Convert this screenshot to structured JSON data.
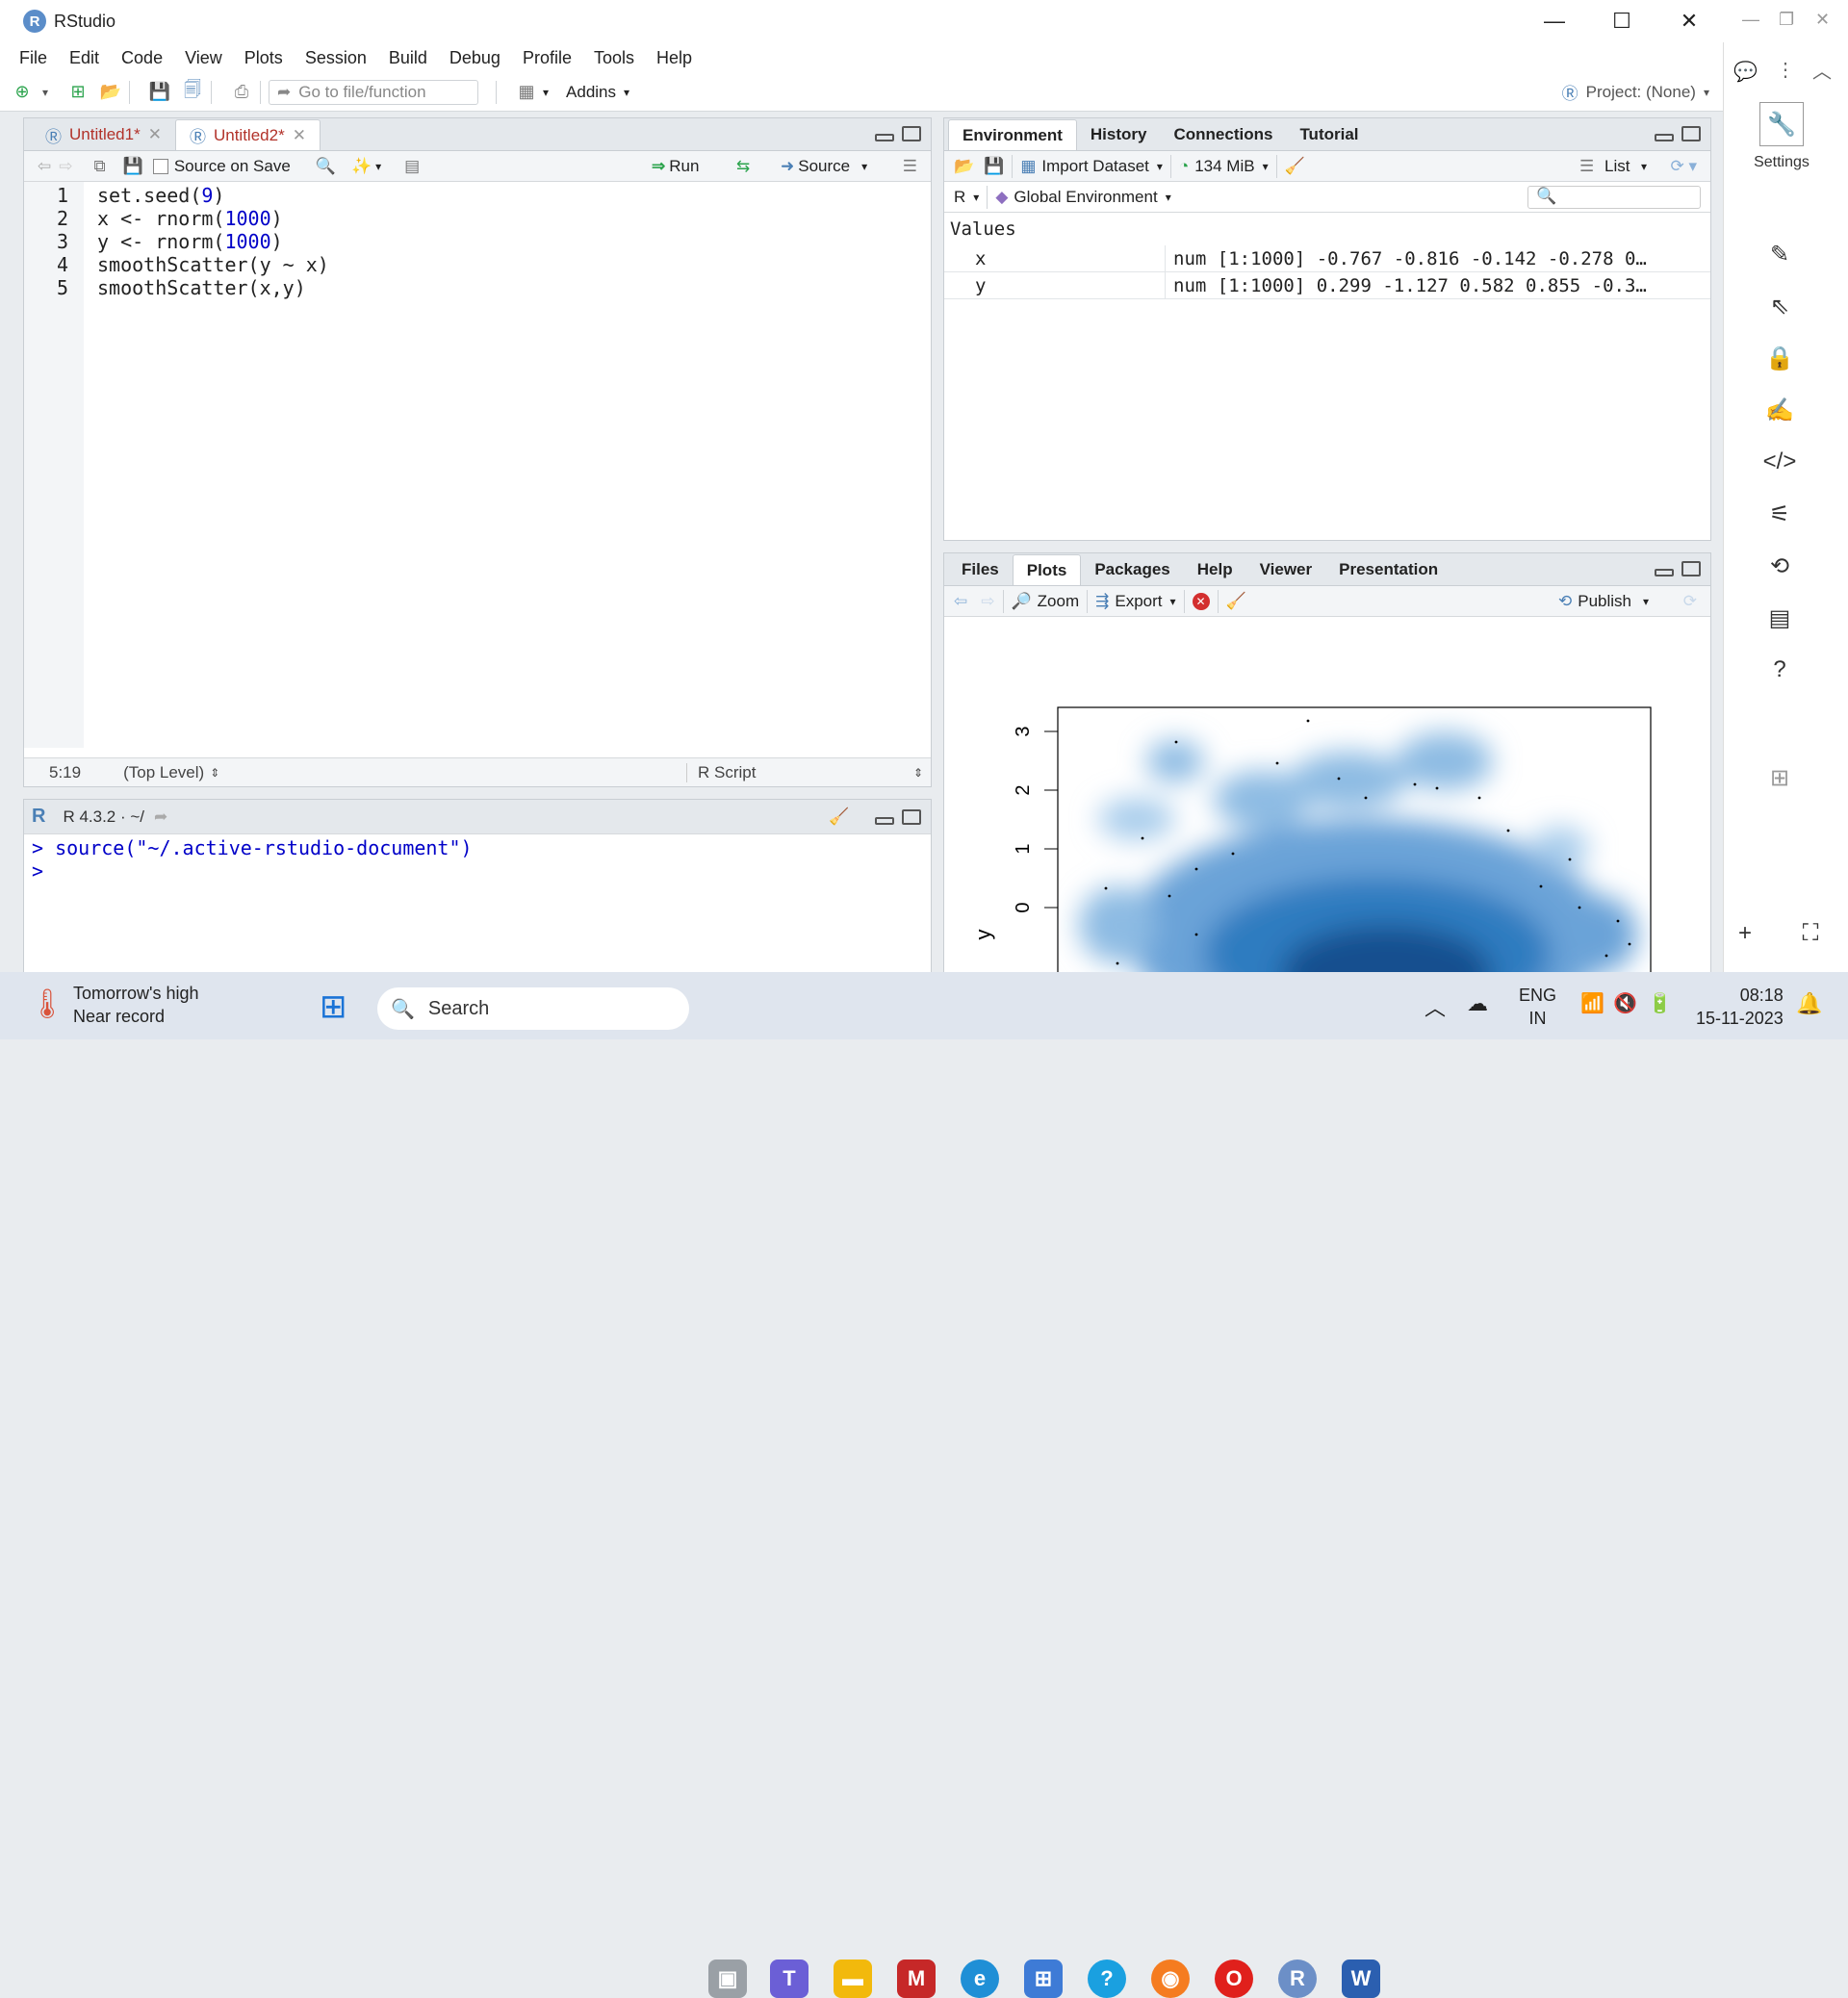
{
  "window": {
    "title": "RStudio",
    "logo": "R"
  },
  "menu": [
    "File",
    "Edit",
    "Code",
    "View",
    "Plots",
    "Session",
    "Build",
    "Debug",
    "Profile",
    "Tools",
    "Help"
  ],
  "toolbar": {
    "goto_placeholder": "Go to file/function",
    "addins": "Addins",
    "project": "Project: (None)"
  },
  "editor": {
    "tabs": [
      "Untitled1*",
      "Untitled2*"
    ],
    "source_on_save": "Source on Save",
    "run": "Run",
    "source": "Source",
    "lines": [
      {
        "n": "1",
        "parts": [
          {
            "t": "set.seed(",
            "c": "kw"
          },
          {
            "t": "9",
            "c": "num"
          },
          {
            "t": ")",
            "c": "kw"
          }
        ]
      },
      {
        "n": "2",
        "parts": [
          {
            "t": "x <- rnorm(",
            "c": "kw"
          },
          {
            "t": "1000",
            "c": "num"
          },
          {
            "t": ")",
            "c": "kw"
          }
        ]
      },
      {
        "n": "3",
        "parts": [
          {
            "t": "y <- rnorm(",
            "c": "kw"
          },
          {
            "t": "1000",
            "c": "num"
          },
          {
            "t": ")",
            "c": "kw"
          }
        ]
      },
      {
        "n": "4",
        "parts": [
          {
            "t": "smoothScatter(y ~ x)",
            "c": "kw"
          }
        ]
      },
      {
        "n": "5",
        "parts": [
          {
            "t": "smoothScatter(x,y)",
            "c": "kw"
          }
        ]
      }
    ],
    "status_pos": "5:19",
    "status_scope": "(Top Level)",
    "status_type": "R Script"
  },
  "console": {
    "version": "R 4.3.2 · ~/",
    "lines": [
      "> source(\"~/.active-rstudio-document\")",
      "> "
    ]
  },
  "environment": {
    "tabs": [
      "Environment",
      "History",
      "Connections",
      "Tutorial"
    ],
    "import": "Import Dataset",
    "memory": "134 MiB",
    "view": "List",
    "lang": "R",
    "scope": "Global Environment",
    "section": "Values",
    "values": [
      {
        "name": "x",
        "value": "num [1:1000] -0.767 -0.816 -0.142 -0.278 0…"
      },
      {
        "name": "y",
        "value": "num [1:1000] 0.299 -1.127 0.582 0.855 -0.3…"
      }
    ]
  },
  "files": {
    "tabs": [
      "Files",
      "Plots",
      "Packages",
      "Help",
      "Viewer",
      "Presentation"
    ],
    "zoom": "Zoom",
    "export": "Export",
    "publish": "Publish"
  },
  "plot": {
    "ylabel": "y",
    "yticks": [
      "0",
      "1",
      "2",
      "3"
    ]
  },
  "sidebar": {
    "settings": "Settings"
  },
  "taskbar": {
    "weather1": "Tomorrow's high",
    "weather2": "Near record",
    "search": "Search",
    "lang1": "ENG",
    "lang2": "IN",
    "time": "08:18",
    "date": "15-11-2023"
  },
  "colors": {
    "accent": "#4a7fb5",
    "plot_blue": "#1f6fb5"
  }
}
